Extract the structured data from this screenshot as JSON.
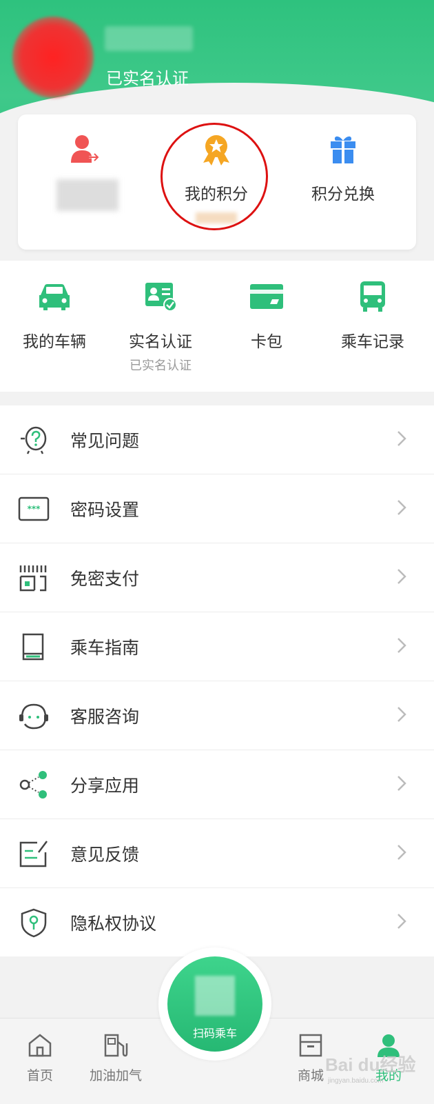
{
  "profile": {
    "verified_text": "已实名认证"
  },
  "points_card": {
    "items": [
      {
        "label": "",
        "icon": "user-transfer-icon"
      },
      {
        "label": "我的积分",
        "icon": "medal-icon"
      },
      {
        "label": "积分兑换",
        "icon": "gift-icon"
      }
    ]
  },
  "quick_actions": [
    {
      "label": "我的车辆",
      "sub": "",
      "icon": "car-icon"
    },
    {
      "label": "实名认证",
      "sub": "已实名认证",
      "icon": "id-card-icon"
    },
    {
      "label": "卡包",
      "sub": "",
      "icon": "card-wallet-icon"
    },
    {
      "label": "乘车记录",
      "sub": "",
      "icon": "bus-icon"
    }
  ],
  "menu": [
    {
      "label": "常见问题",
      "icon": "question-icon"
    },
    {
      "label": "密码设置",
      "icon": "password-icon"
    },
    {
      "label": "免密支付",
      "icon": "qr-pay-icon"
    },
    {
      "label": "乘车指南",
      "icon": "guide-book-icon"
    },
    {
      "label": "客服咨询",
      "icon": "customer-service-icon"
    },
    {
      "label": "分享应用",
      "icon": "share-icon"
    },
    {
      "label": "意见反馈",
      "icon": "feedback-icon"
    },
    {
      "label": "隐私权协议",
      "icon": "privacy-shield-icon"
    }
  ],
  "tabbar": {
    "tabs": [
      {
        "label": "首页",
        "icon": "home-icon"
      },
      {
        "label": "加油加气",
        "icon": "fuel-icon"
      },
      {
        "label": "商城",
        "icon": "store-icon"
      },
      {
        "label": "我的",
        "icon": "profile-icon"
      }
    ],
    "scan_label": "扫码乘车",
    "active_color": "#2fbf7b"
  },
  "colors": {
    "brand_green": "#2ec27e",
    "highlight_red": "#d11"
  },
  "watermark": {
    "main": "Bai du经验",
    "sub": "jingyan.baidu.com"
  }
}
